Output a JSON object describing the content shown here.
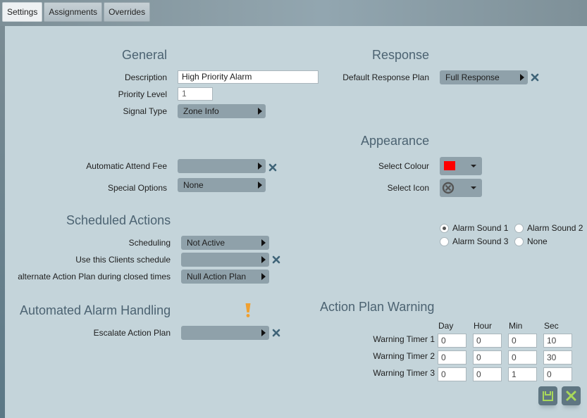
{
  "tabs": [
    {
      "label": "Settings",
      "active": true
    },
    {
      "label": "Assignments",
      "active": false
    },
    {
      "label": "Overrides",
      "active": false
    }
  ],
  "general": {
    "heading": "General",
    "description_label": "Description",
    "description_value": "High Priority Alarm",
    "priority_label": "Priority Level",
    "priority_value": "1",
    "signal_type_label": "Signal Type",
    "signal_type_value": "Zone Info",
    "attend_fee_label": "Automatic Attend Fee",
    "attend_fee_value": "",
    "special_options_label": "Special Options",
    "special_options_value": "None"
  },
  "response": {
    "heading": "Response",
    "default_plan_label": "Default Response Plan",
    "default_plan_value": "Full Response"
  },
  "appearance": {
    "heading": "Appearance",
    "colour_label": "Select Colour",
    "colour_value": "#ff0000",
    "icon_label": "Select Icon",
    "icon_value": "circle-x-icon",
    "sounds": [
      {
        "label": "Alarm Sound 1",
        "checked": true
      },
      {
        "label": "Alarm Sound 2",
        "checked": false
      },
      {
        "label": "Alarm Sound 3",
        "checked": false
      },
      {
        "label": "None",
        "checked": false
      }
    ]
  },
  "scheduled": {
    "heading": "Scheduled Actions",
    "scheduling_label": "Scheduling",
    "scheduling_value": "Not Active",
    "client_schedule_label": "Use this Clients schedule",
    "client_schedule_value": "",
    "alternate_label": "alternate Action Plan during closed times",
    "alternate_value": "Null Action Plan"
  },
  "automated": {
    "heading": "Automated Alarm Handling",
    "warning_icon": "exclamation-icon",
    "warning_color": "#f0a030",
    "escalate_label": "Escalate Action Plan",
    "escalate_value": ""
  },
  "warning": {
    "heading": "Action Plan Warning",
    "columns": [
      "Day",
      "Hour",
      "Min",
      "Sec"
    ],
    "timers": [
      {
        "label": "Warning Timer 1",
        "values": [
          "0",
          "0",
          "0",
          "10"
        ]
      },
      {
        "label": "Warning Timer 2",
        "values": [
          "0",
          "0",
          "0",
          "30"
        ]
      },
      {
        "label": "Warning Timer 3",
        "values": [
          "0",
          "0",
          "1",
          "0"
        ]
      }
    ]
  },
  "actions": {
    "save_icon": "save-icon",
    "cancel_icon": "close-icon",
    "accent": "#a8d85a"
  }
}
